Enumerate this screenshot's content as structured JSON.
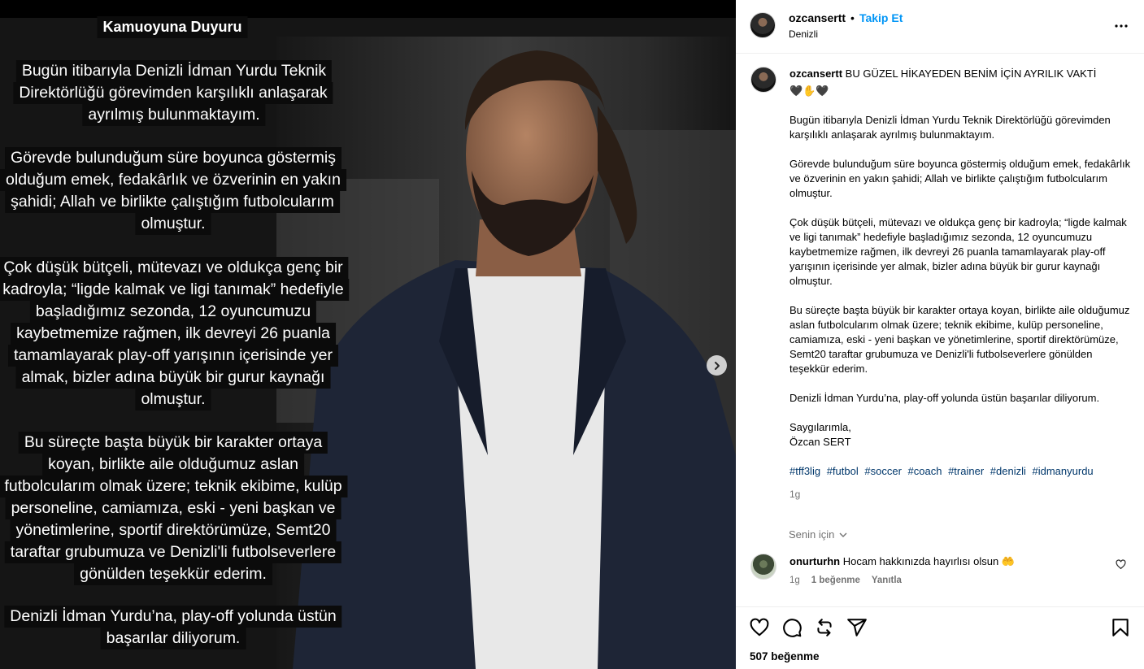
{
  "media": {
    "heading": "Kamuoyuna Duyuru",
    "lines": [
      "Bugün itibarıyla Denizli İdman Yurdu Teknik",
      "Direktörlüğü görevimden karşılıklı anlaşarak",
      "ayrılmış bulunmaktayım.",
      "Görevde bulunduğum süre boyunca göstermiş",
      "olduğum emek, fedakârlık ve özverinin en yakın",
      "şahidi; Allah ve birlikte çalıştığım futbolcularım",
      "olmuştur.",
      "Çok düşük bütçeli, mütevazı ve oldukça genç bir",
      "kadroyla; “ligde kalmak ve ligi tanımak” hedefiyle",
      "başladığımız sezonda, 12 oyuncumuzu",
      "kaybetmemize rağmen, ilk devreyi 26 puanla",
      "tamamlayarak play-off yarışının içerisinde yer",
      "almak, bizler adına büyük bir gurur kaynağı",
      "olmuştur.",
      "Bu süreçte başta büyük bir karakter ortaya",
      "koyan, birlikte aile olduğumuz aslan",
      "futbolcularım olmak üzere; teknik ekibime, kulüp",
      "personeline, camiamıza, eski - yeni başkan ve",
      "yönetimlerine, sportif direktörümüze, Semt20",
      "taraftar grubumuza ve Denizli'li futbolseverlere",
      "gönülden teşekkür ederim.",
      "Denizli İdman Yurdu’na, play-off yolunda üstün",
      "başarılar diliyorum."
    ],
    "next_icon": "chevron-right-icon"
  },
  "header": {
    "username": "ozcansertt",
    "separator": "•",
    "follow_label": "Takip Et",
    "location": "Denizli",
    "more_icon": "more-horizontal-icon"
  },
  "caption": {
    "username": "ozcansertt",
    "title": "BU GÜZEL HİKAYEDEN BENİM İÇİN AYRILIK VAKTİ",
    "emoji": "🖤✋🖤",
    "paragraphs": [
      "Bugün itibarıyla Denizli İdman Yurdu Teknik Direktörlüğü görevimden karşılıklı anlaşarak ayrılmış bulunmaktayım.",
      "Görevde bulunduğum süre boyunca göstermiş olduğum emek, fedakârlık ve özverinin en yakın şahidi; Allah ve birlikte çalıştığım futbolcularım olmuştur.",
      "Çok düşük bütçeli, mütevazı ve oldukça genç bir kadroyla; “ligde kalmak ve ligi tanımak” hedefiyle başladığımız sezonda, 12 oyuncumuzu kaybetmemize rağmen, ilk devreyi 26 puanla tamamlayarak play-off yarışının içerisinde yer almak, bizler adına büyük bir gurur kaynağı olmuştur.",
      "Bu süreçte başta büyük bir karakter ortaya koyan, birlikte aile olduğumuz aslan futbolcularım olmak üzere; teknik ekibime, kulüp personeline, camiamıza, eski - yeni başkan ve yönetimlerine, sportif direktörümüze, Semt20 taraftar grubumuza ve Denizli'li futbolseverlere gönülden teşekkür ederim.",
      "Denizli İdman Yurdu’na, play-off yolunda üstün başarılar diliyorum.",
      "Saygılarımla,\nÖzcan SERT"
    ],
    "hashtags": [
      "#tff3lig",
      "#futbol",
      "#soccer",
      "#coach",
      "#trainer",
      "#denizli",
      "#idmanyurdu"
    ],
    "time": "1g"
  },
  "for_you": {
    "label": "Senin için",
    "icon": "chevron-down-icon"
  },
  "comment": {
    "username": "onurturhn",
    "text": "Hocam hakkınızda hayırlısı olsun",
    "emoji": "🤲",
    "time": "1g",
    "likes": "1 beğenme",
    "reply": "Yanıtla"
  },
  "actions": {
    "like_icon": "heart-icon",
    "comment_icon": "comment-icon",
    "share_icon": "repost-icon",
    "send_icon": "send-icon",
    "save_icon": "bookmark-icon"
  },
  "likes_text": "507 beğenme"
}
